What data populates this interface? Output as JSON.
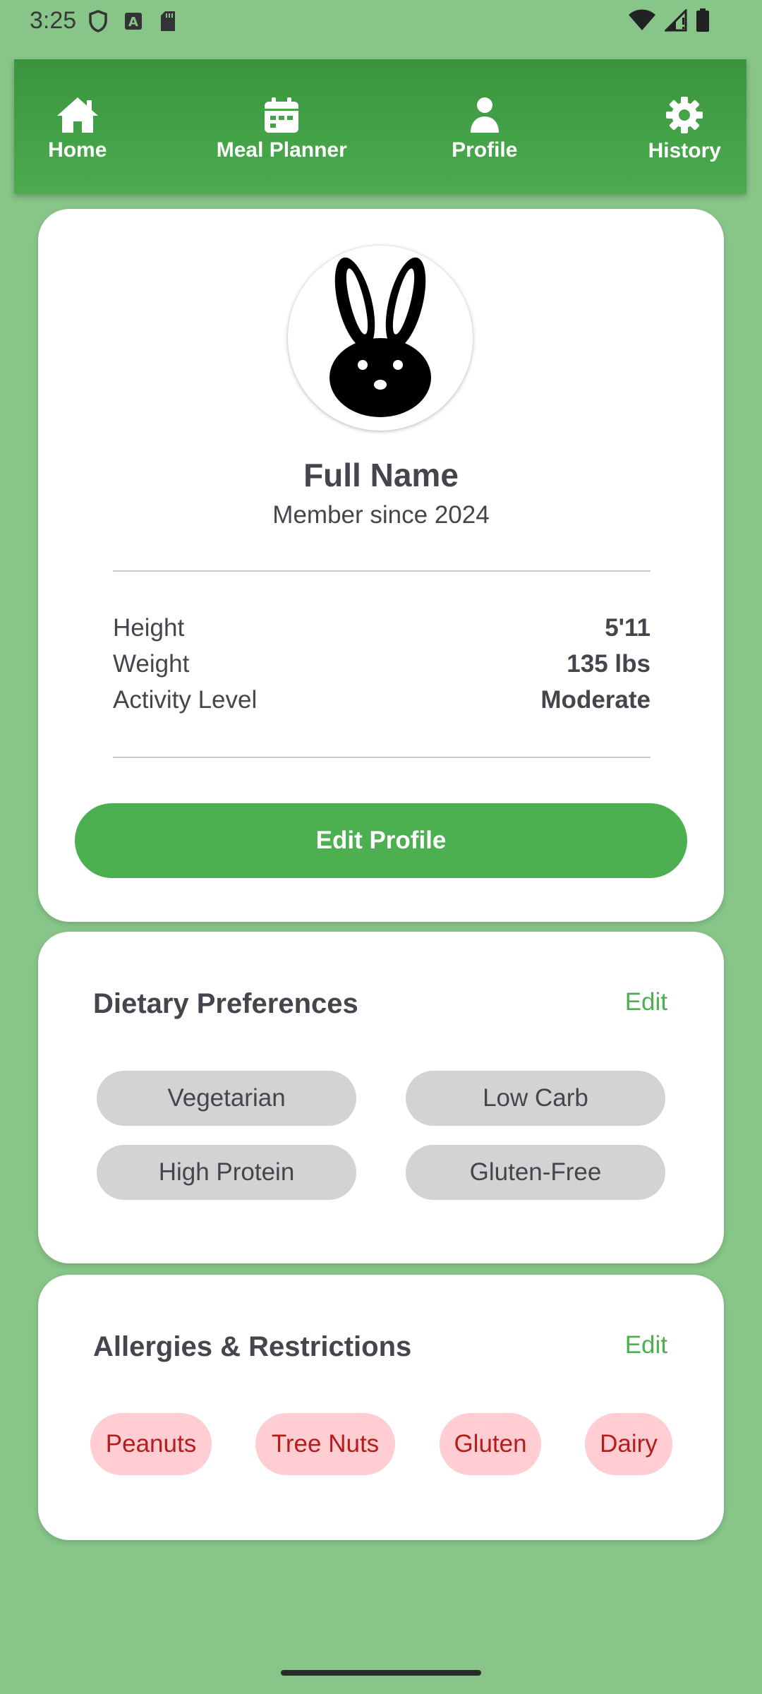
{
  "status_bar": {
    "time": "3:25",
    "left_icons": [
      "shield-icon",
      "a-badge-icon",
      "sd-card-icon"
    ],
    "right_icons": [
      "wifi-icon",
      "signal-icon",
      "battery-icon"
    ]
  },
  "nav": {
    "items": [
      {
        "label": "Home",
        "icon": "home-icon"
      },
      {
        "label": "Meal Planner",
        "icon": "calendar-icon"
      },
      {
        "label": "Profile",
        "icon": "person-icon"
      },
      {
        "label": "History",
        "icon": "gear-icon"
      }
    ]
  },
  "profile": {
    "avatar_icon": "rabbit-icon",
    "name": "Full Name",
    "member_since": "Member since 2024",
    "stats": [
      {
        "label": "Height",
        "value": "5'11"
      },
      {
        "label": "Weight",
        "value": "135 lbs"
      },
      {
        "label": "Activity Level",
        "value": "Moderate"
      }
    ],
    "edit_button": "Edit Profile"
  },
  "dietary": {
    "title": "Dietary Preferences",
    "edit": "Edit",
    "items": [
      "Vegetarian",
      "Low Carb",
      "High Protein",
      "Gluten-Free"
    ]
  },
  "allergies": {
    "title": "Allergies & Restrictions",
    "edit": "Edit",
    "items": [
      "Peanuts",
      "Tree Nuts",
      "Gluten",
      "Dairy"
    ]
  },
  "colors": {
    "background": "#87c588",
    "nav": "#43a047",
    "accent": "#4caf50",
    "allergy_chip": "#ffcdd2",
    "allergy_text": "#b71c1c"
  }
}
